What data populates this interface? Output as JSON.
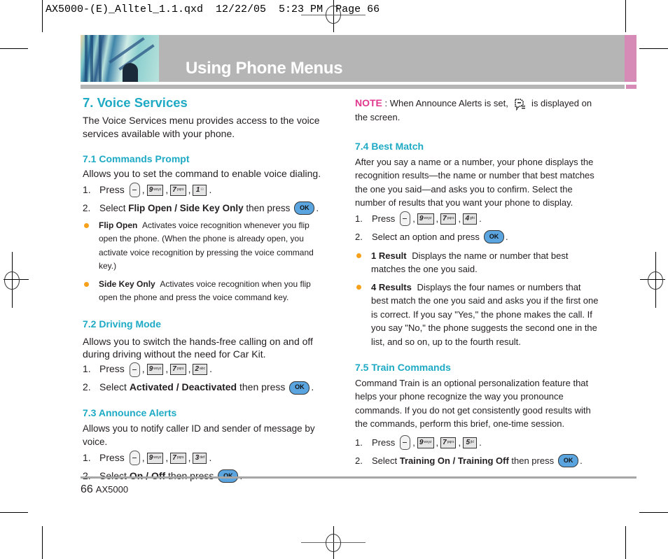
{
  "slug": "AX5000-(E)_Alltel_1.1.qxd  12/22/05  5:23 PM  Page 66",
  "header": {
    "title": "Using Phone Menus",
    "accent_color": "#d58bb5",
    "band_color": "#b6b5b6"
  },
  "section": {
    "title": "7. Voice Services",
    "intro": "The Voice Services menu provides access to the voice services available with your phone."
  },
  "s71": {
    "title": "7.1 Commands Prompt",
    "body": "Allows you to set the command to enable voice dialing.",
    "step1": {
      "num": "1.",
      "label": "Press",
      "keys": [
        "9",
        "7",
        "1"
      ],
      "subs": [
        "wxyz",
        "pqrs",
        "⚇"
      ]
    },
    "step2": {
      "num": "2.",
      "pre": "Select ",
      "b1": "Flip Open",
      "sep": " / ",
      "b2": "Side Key Only",
      "post": " then press"
    },
    "bullets": [
      {
        "term": "Flip Open",
        "text": "Activates voice recognition whenever you flip open the phone. (When the phone is already open, you activate voice recognition by pressing the voice command key.)"
      },
      {
        "term": "Side Key Only",
        "text": "Activates voice recognition when you flip open the phone and press the voice command key."
      }
    ]
  },
  "s72": {
    "title": "7.2 Driving Mode",
    "body": "Allows you to switch the hands-free calling on and off during driving without the need for Car Kit.",
    "step1": {
      "num": "1.",
      "label": "Press",
      "keys": [
        "9",
        "7",
        "2"
      ],
      "subs": [
        "wxyz",
        "pqrs",
        "abc"
      ]
    },
    "step2": {
      "num": "2.",
      "pre": "Select ",
      "b1": "Activated",
      "sep": " / ",
      "b2": "Deactivated",
      "post": " then press"
    }
  },
  "s73": {
    "title": "7.3 Announce Alerts",
    "body": "Allows you to notify caller ID and sender of message by voice.",
    "step1": {
      "num": "1.",
      "label": "Press",
      "keys": [
        "9",
        "7",
        "3"
      ],
      "subs": [
        "wxyz",
        "pqrs",
        "def"
      ]
    },
    "step2": {
      "num": "2.",
      "pre": "Select ",
      "b1": "On",
      "sep": " / ",
      "b2": "Off",
      "post": " then press"
    }
  },
  "note": {
    "label": "NOTE",
    "pre": " : When Announce Alerts is set, ",
    "post": " is displayed on the screen.",
    "icon": "announce-alert-icon"
  },
  "s74": {
    "title": "7.4 Best Match",
    "body": "After you say a name or a number, your phone displays the recognition results—the name or number that best matches the one you said—and asks you to confirm. Select the number of results that you want your phone to display.",
    "step1": {
      "num": "1.",
      "label": "Press",
      "keys": [
        "9",
        "7",
        "4"
      ],
      "subs": [
        "wxyz",
        "pqrs",
        "ghi"
      ]
    },
    "step2": {
      "num": "2.",
      "text": "Select an option and press"
    },
    "bullets": [
      {
        "term": "1 Result",
        "text": "Displays the name or number that best matches the one you said."
      },
      {
        "term": "4 Results",
        "text": "Displays the four names or numbers that best match the one you said and asks you if the first one is correct. If you say \"Yes,\" the phone makes the call. If you say \"No,\" the phone suggests the second one in the list, and so on, up to the fourth result."
      }
    ]
  },
  "s75": {
    "title": "7.5 Train Commands",
    "body": "Command Train is an optional personalization feature that helps your phone recognize the way you pronounce commands. If you do not get consistently good results with the commands, perform this brief, one-time session.",
    "step1": {
      "num": "1.",
      "label": "Press",
      "keys": [
        "9",
        "7",
        "5"
      ],
      "subs": [
        "wxyz",
        "pqrs",
        "jkl"
      ]
    },
    "step2": {
      "num": "2.",
      "pre": "Select ",
      "b1": "Training On",
      "sep": " / ",
      "b2": "Training Off",
      "post": " then press"
    }
  },
  "keys": {
    "ok_label": "OK",
    "comma": ",",
    "period": "."
  },
  "footer": {
    "page": "66",
    "model": "AX5000"
  }
}
